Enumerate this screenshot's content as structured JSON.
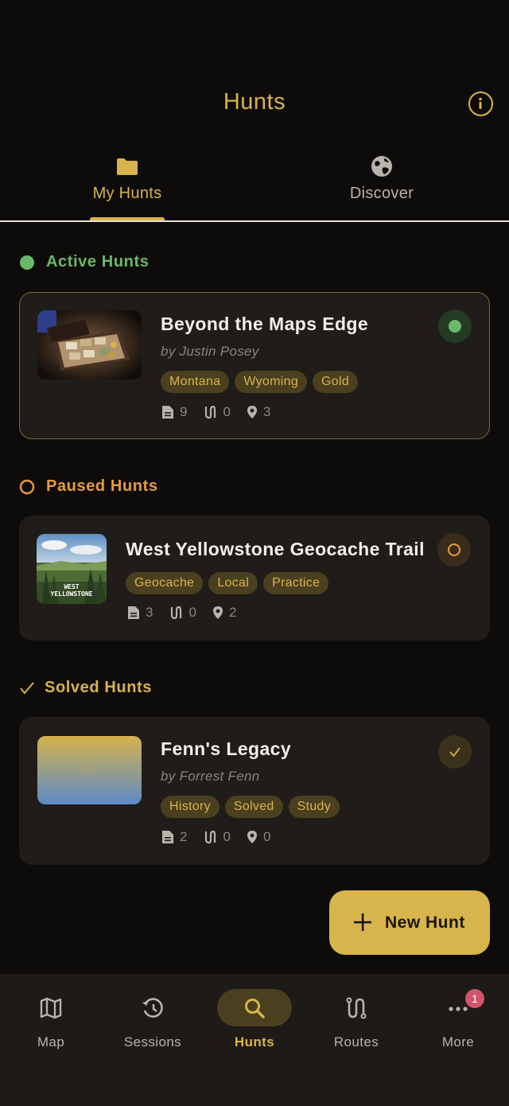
{
  "header": {
    "title": "Hunts",
    "info_icon": "info-icon"
  },
  "tabs": [
    {
      "label": "My Hunts",
      "icon": "folder-icon",
      "selected": true
    },
    {
      "label": "Discover",
      "icon": "globe-icon",
      "selected": false
    }
  ],
  "sections": {
    "active": {
      "label": "Active Hunts",
      "color": "#6ab86a"
    },
    "paused": {
      "label": "Paused Hunts",
      "color": "#e89a3c"
    },
    "solved": {
      "label": "Solved Hunts",
      "color": "#d8b44c"
    }
  },
  "hunts": [
    {
      "title": "Beyond the Maps Edge",
      "author": "by Justin Posey",
      "tags": [
        "Montana",
        "Wyoming",
        "Gold"
      ],
      "stats": {
        "documents": "9",
        "routes": "0",
        "locations": "3"
      },
      "status": "active"
    },
    {
      "title": "West Yellowstone Geocache Trail",
      "thumbnail_text": "WEST YELLOWSTONE",
      "tags": [
        "Geocache",
        "Local",
        "Practice"
      ],
      "stats": {
        "documents": "3",
        "routes": "0",
        "locations": "2"
      },
      "status": "paused"
    },
    {
      "title": "Fenn's Legacy",
      "author": "by Forrest Fenn",
      "tags": [
        "History",
        "Solved",
        "Study"
      ],
      "stats": {
        "documents": "2",
        "routes": "0",
        "locations": "0"
      },
      "status": "solved"
    }
  ],
  "fab": {
    "label": "New Hunt",
    "icon": "plus-icon"
  },
  "bottom_nav": [
    {
      "label": "Map",
      "icon": "map-icon"
    },
    {
      "label": "Sessions",
      "icon": "history-icon"
    },
    {
      "label": "Hunts",
      "icon": "search-icon",
      "selected": true
    },
    {
      "label": "Routes",
      "icon": "route-icon"
    },
    {
      "label": "More",
      "icon": "more-icon",
      "badge": "1"
    }
  ],
  "colors": {
    "accent": "#d8b44c",
    "background": "#0e0c0b",
    "card": "#1f1c19",
    "tag_bg": "#4a3f1f"
  }
}
